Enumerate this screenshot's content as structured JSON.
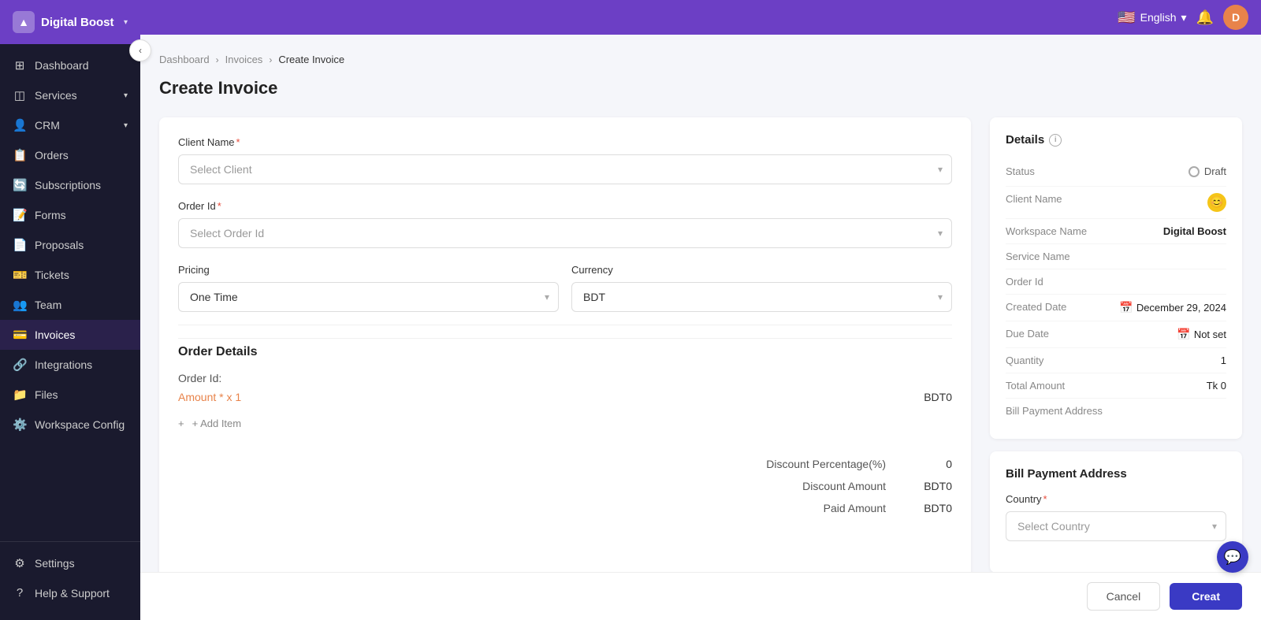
{
  "app": {
    "name": "Digital Boost",
    "collapse_icon": "‹"
  },
  "topbar": {
    "language": "English",
    "flag": "🇺🇸",
    "chevron": "▾"
  },
  "sidebar": {
    "items": [
      {
        "id": "dashboard",
        "label": "Dashboard",
        "icon": "⊞",
        "hasChevron": false
      },
      {
        "id": "services",
        "label": "Services",
        "icon": "📦",
        "hasChevron": true
      },
      {
        "id": "crm",
        "label": "CRM",
        "icon": "👤",
        "hasChevron": true
      },
      {
        "id": "orders",
        "label": "Orders",
        "icon": "📋",
        "hasChevron": false
      },
      {
        "id": "subscriptions",
        "label": "Subscriptions",
        "icon": "🔄",
        "hasChevron": false
      },
      {
        "id": "forms",
        "label": "Forms",
        "icon": "📝",
        "hasChevron": false
      },
      {
        "id": "proposals",
        "label": "Proposals",
        "icon": "📄",
        "hasChevron": false
      },
      {
        "id": "tickets",
        "label": "Tickets",
        "icon": "🎫",
        "hasChevron": false
      },
      {
        "id": "team",
        "label": "Team",
        "icon": "👥",
        "hasChevron": false
      },
      {
        "id": "invoices",
        "label": "Invoices",
        "icon": "💳",
        "hasChevron": false,
        "active": true
      },
      {
        "id": "integrations",
        "label": "Integrations",
        "icon": "🔗",
        "hasChevron": false
      },
      {
        "id": "files",
        "label": "Files",
        "icon": "📁",
        "hasChevron": false
      },
      {
        "id": "workspace-config",
        "label": "Workspace Config",
        "icon": "⚙️",
        "hasChevron": false
      }
    ],
    "bottom": [
      {
        "id": "settings",
        "label": "Settings",
        "icon": "⚙"
      },
      {
        "id": "help",
        "label": "Help & Support",
        "icon": "?"
      }
    ]
  },
  "breadcrumb": {
    "items": [
      "Dashboard",
      "Invoices",
      "Create Invoice"
    ],
    "separators": [
      ">",
      ">"
    ]
  },
  "page": {
    "title": "Create Invoice"
  },
  "form": {
    "client_name_label": "Client Name",
    "client_name_placeholder": "Select Client",
    "order_id_label": "Order Id",
    "order_id_placeholder": "Select Order Id",
    "pricing_label": "Pricing",
    "pricing_value": "One Time",
    "currency_label": "Currency",
    "currency_value": "BDT",
    "order_details_title": "Order Details",
    "order_id_row_label": "Order Id:",
    "amount_label": "Amount * x 1",
    "amount_value": "BDT0",
    "add_item_label": "+ Add Item",
    "discount_percentage_label": "Discount Percentage(%)",
    "discount_percentage_value": "0",
    "discount_amount_label": "Discount Amount",
    "discount_amount_value": "BDT0",
    "paid_amount_label": "Paid Amount",
    "paid_amount_value": "BDT0"
  },
  "details": {
    "title": "Details",
    "status_label": "Status",
    "status_value": "Draft",
    "client_name_label": "Client Name",
    "workspace_label": "Workspace Name",
    "workspace_value": "Digital Boost",
    "service_label": "Service Name",
    "service_value": "",
    "order_id_label": "Order Id",
    "order_id_value": "",
    "created_date_label": "Created Date",
    "created_date_value": "December 29, 2024",
    "due_date_label": "Due Date",
    "due_date_value": "Not set",
    "quantity_label": "Quantity",
    "quantity_value": "1",
    "total_amount_label": "Total Amount",
    "total_amount_value": "Tk 0",
    "bill_payment_label": "Bill Payment Address",
    "bill_payment_value": ""
  },
  "bill_payment": {
    "title": "Bill Payment Address",
    "country_label": "Country",
    "country_placeholder": "Select Country"
  },
  "actions": {
    "cancel_label": "Cancel",
    "create_label": "Creat"
  }
}
